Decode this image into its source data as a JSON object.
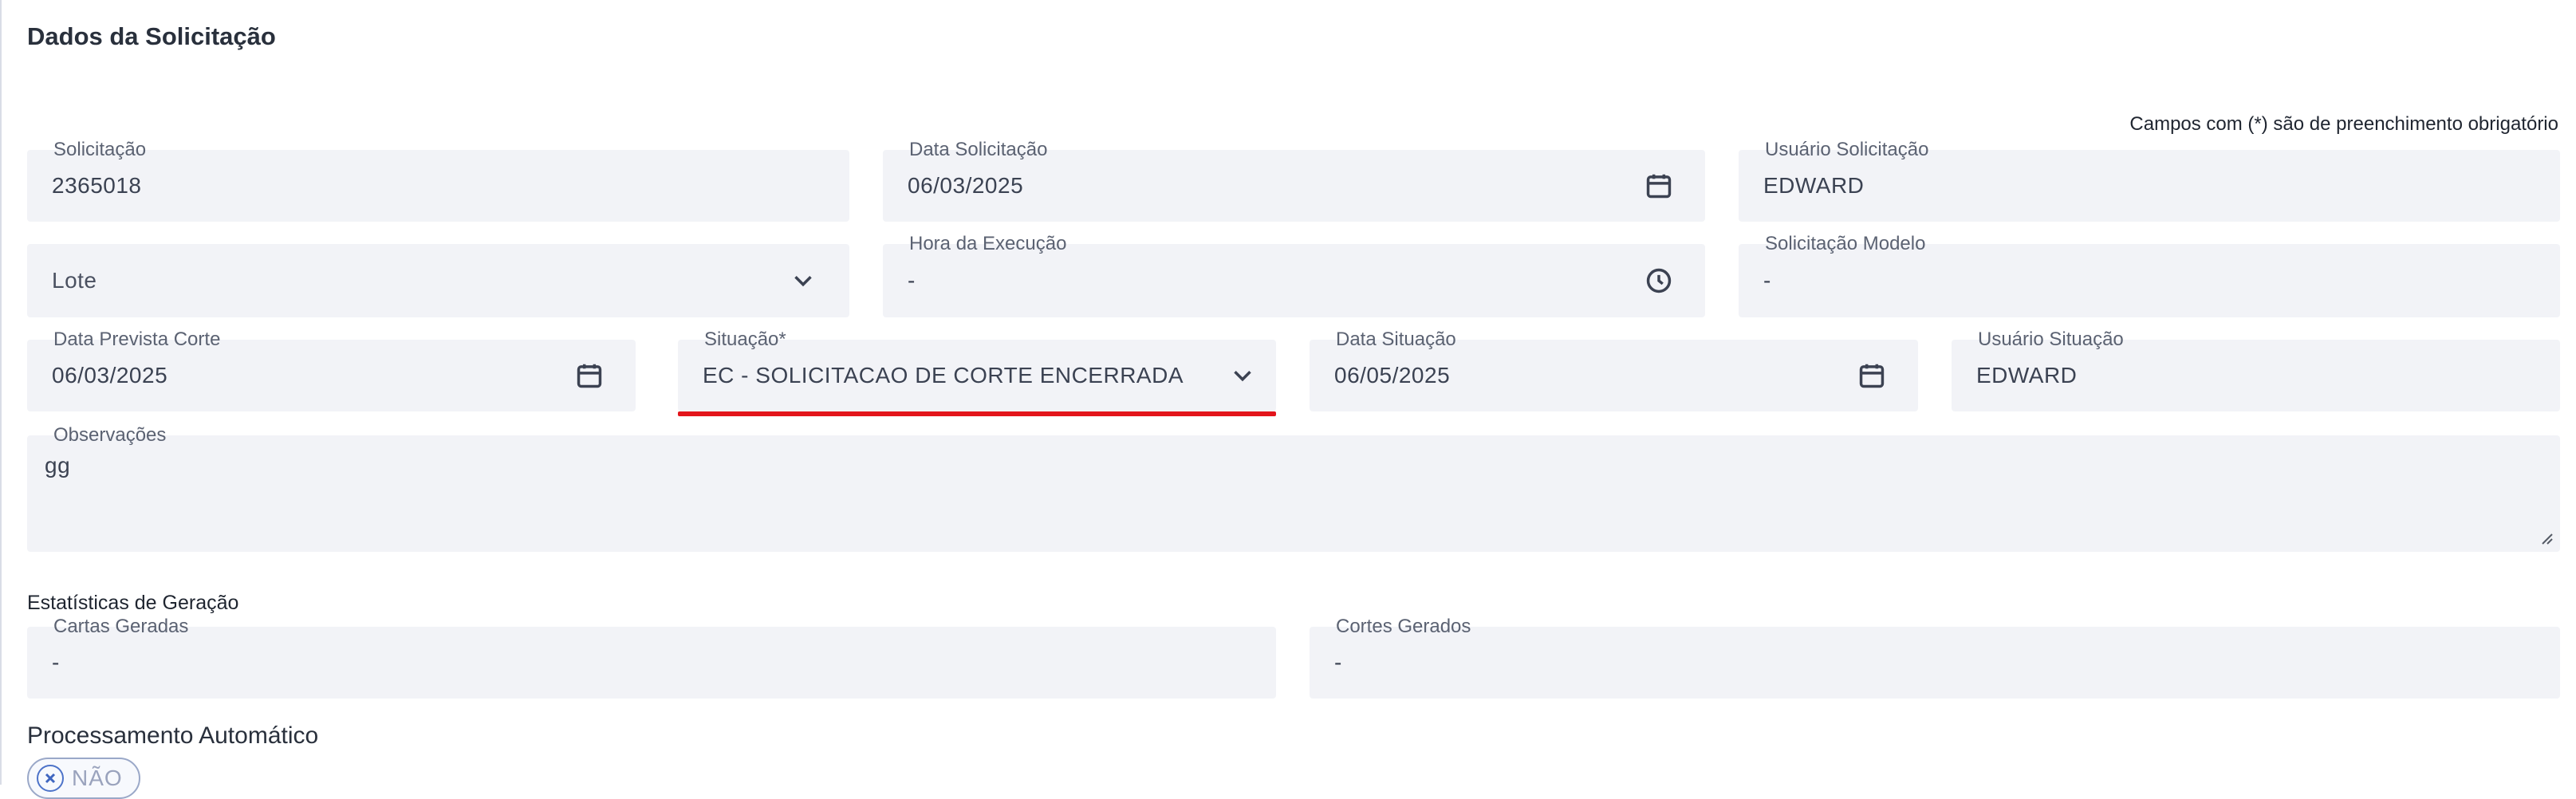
{
  "section": {
    "title": "Dados da Solicitação",
    "required_note": "Campos com (*) são de preenchimento obrigatório"
  },
  "fields": {
    "solicitacao": {
      "label": "Solicitação",
      "value": "2365018"
    },
    "data_solicitacao": {
      "label": "Data Solicitação",
      "value": "06/03/2025",
      "icon": "calendar-icon"
    },
    "usuario_solicitacao": {
      "label": "Usuário Solicitação",
      "value": "EDWARD"
    },
    "lote": {
      "placeholder": "Lote",
      "icon": "chevron-down-icon"
    },
    "hora_execucao": {
      "label": "Hora da Execução",
      "value": "-",
      "icon": "clock-icon"
    },
    "solicitacao_modelo": {
      "label": "Solicitação Modelo",
      "value": "-"
    },
    "data_prevista_corte": {
      "label": "Data Prevista Corte",
      "value": "06/03/2025",
      "icon": "calendar-icon"
    },
    "situacao": {
      "label": "Situação*",
      "value": "EC - SOLICITACAO DE CORTE ENCERRADA",
      "icon": "chevron-down-icon",
      "error_color": "#e3151b"
    },
    "data_situacao": {
      "label": "Data Situação",
      "value": "06/05/2025",
      "icon": "calendar-icon"
    },
    "usuario_situacao": {
      "label": "Usuário Situação",
      "value": "EDWARD"
    },
    "observacoes": {
      "label": "Observações",
      "value": "gg"
    }
  },
  "estatisticas": {
    "title": "Estatísticas de Geração",
    "cartas_geradas": {
      "label": "Cartas Geradas",
      "value": "-"
    },
    "cortes_gerados": {
      "label": "Cortes Gerados",
      "value": "-"
    }
  },
  "processamento": {
    "label": "Processamento Automático",
    "toggle_text": "NÃO",
    "icon": "close-icon"
  },
  "colors": {
    "field_bg": "#f2f3f7",
    "accent": "#4d73c9",
    "error": "#e3151b"
  }
}
